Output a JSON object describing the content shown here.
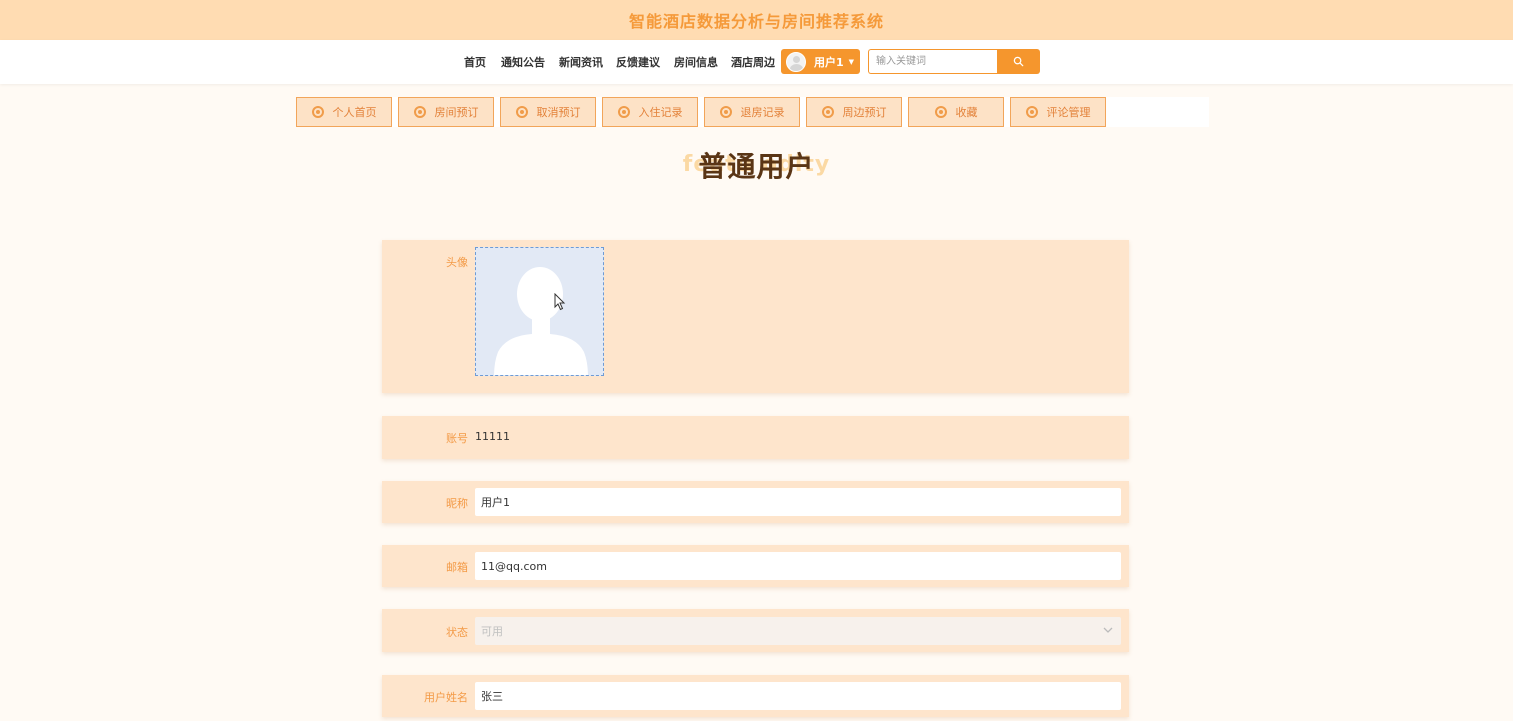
{
  "header": {
    "title": "智能酒店数据分析与房间推荐系统"
  },
  "nav": {
    "items": [
      "首页",
      "通知公告",
      "新闻资讯",
      "反馈建议",
      "房间信息",
      "酒店周边"
    ],
    "user_name": "用户1",
    "search_placeholder": "输入关键词"
  },
  "subnav": {
    "items": [
      "个人首页",
      "房间预订",
      "取消预订",
      "入住记录",
      "退房记录",
      "周边预订",
      "收藏",
      "评论管理"
    ]
  },
  "page": {
    "title": "普通用户",
    "title_bg": "featu          odity"
  },
  "form": {
    "avatar_label": "头像",
    "account_label": "账号",
    "account_value": "11111",
    "nickname_label": "昵称",
    "nickname_value": "用户1",
    "email_label": "邮箱",
    "email_value": "11@qq.com",
    "status_label": "状态",
    "status_value": "可用",
    "realname_label": "用户姓名",
    "realname_value": "张三"
  },
  "colors": {
    "accent": "#f5962d",
    "header_bg": "#ffdcb2",
    "row_bg": "#fee5cc",
    "title_brown": "#5a3515"
  }
}
